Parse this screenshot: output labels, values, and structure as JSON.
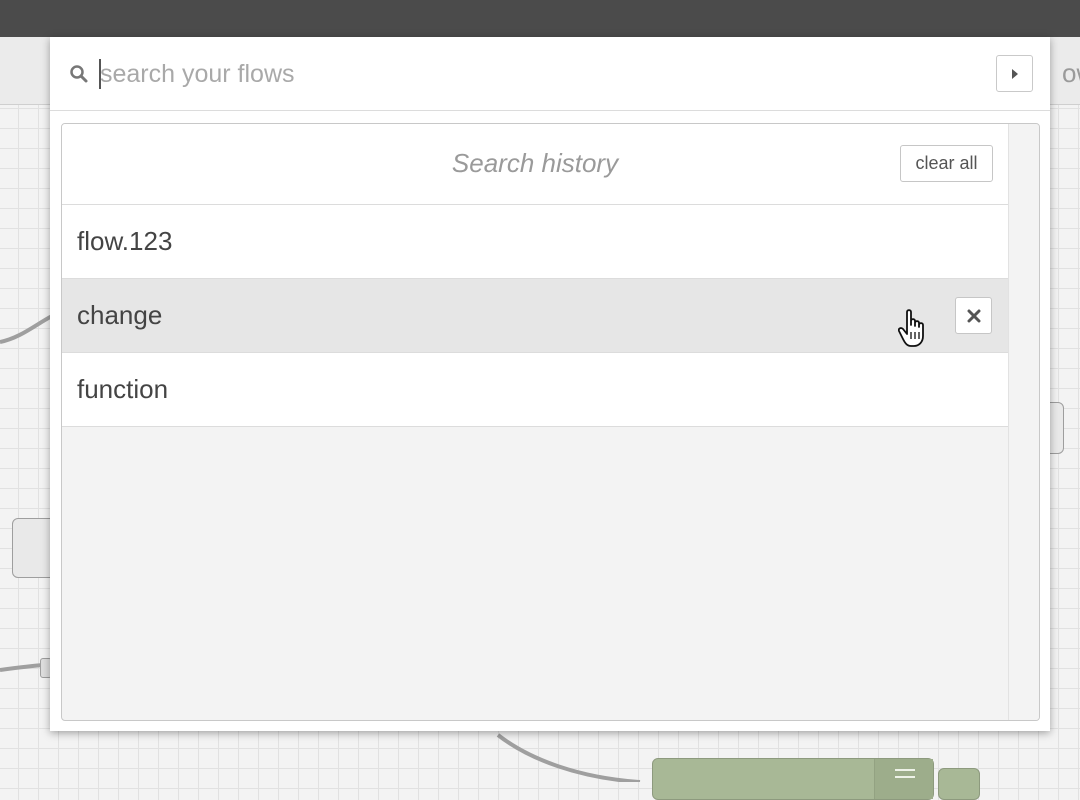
{
  "search": {
    "placeholder": "search your flows",
    "value": ""
  },
  "history": {
    "title": "Search history",
    "clear_label": "clear all",
    "items": [
      {
        "label": "flow.123",
        "hovered": false
      },
      {
        "label": "change",
        "hovered": true
      },
      {
        "label": "function",
        "hovered": false
      }
    ]
  },
  "background": {
    "tab_text_fragment": "ow"
  },
  "icons": {
    "search": "search-icon",
    "expand": "caret-right-icon",
    "remove": "close-icon",
    "cursor": "hand-pointer-icon"
  },
  "colors": {
    "topbar": "#4b4b4b",
    "hover_row": "#e6e6e6",
    "node_green": "#a8b896"
  }
}
